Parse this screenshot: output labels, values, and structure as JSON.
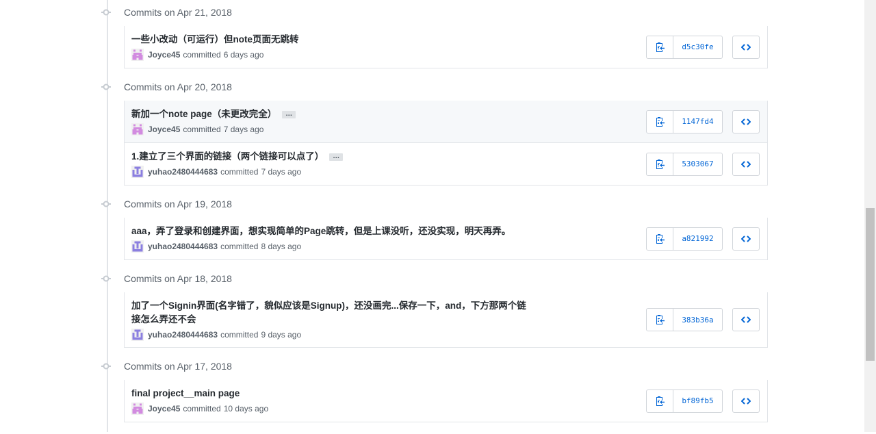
{
  "colors": {
    "accent": "#0366d6",
    "joyce_avatar": "#d28be0",
    "yuhao_avatar": "#8b7fe0"
  },
  "groups": [
    {
      "date_label": "Commits on Apr 21, 2018",
      "commits": [
        {
          "message": "一些小改动（可运行）但note页面无跳转",
          "author": "Joyce45",
          "verb": "committed",
          "time": "6 days ago",
          "sha": "d5c30fe",
          "has_more": false,
          "avatar": "joyce"
        }
      ]
    },
    {
      "date_label": "Commits on Apr 20, 2018",
      "commits": [
        {
          "message": "新加一个note page（未更改完全）",
          "author": "Joyce45",
          "verb": "committed",
          "time": "7 days ago",
          "sha": "1147fd4",
          "has_more": true,
          "more_label": "…",
          "avatar": "joyce",
          "highlight": true
        },
        {
          "message": "1.建立了三个界面的链接（两个链接可以点了）",
          "author": "yuhao2480444683",
          "verb": "committed",
          "time": "7 days ago",
          "sha": "5303067",
          "has_more": true,
          "more_label": "…",
          "avatar": "yuhao"
        }
      ]
    },
    {
      "date_label": "Commits on Apr 19, 2018",
      "commits": [
        {
          "message": "aaa，弄了登录和创建界面，想实现简单的Page跳转，但是上课没听，还没实现，明天再弄。",
          "author": "yuhao2480444683",
          "verb": "committed",
          "time": "8 days ago",
          "sha": "a821992",
          "has_more": false,
          "avatar": "yuhao"
        }
      ]
    },
    {
      "date_label": "Commits on Apr 18, 2018",
      "commits": [
        {
          "message": "加了一个Signin界面(名字错了，貌似应该是Signup)，还没画完...保存一下，and，下方那两个链接怎么弄还不会",
          "author": "yuhao2480444683",
          "verb": "committed",
          "time": "9 days ago",
          "sha": "383b36a",
          "has_more": false,
          "avatar": "yuhao"
        }
      ]
    },
    {
      "date_label": "Commits on Apr 17, 2018",
      "commits": [
        {
          "message": "final project__main page",
          "author": "Joyce45",
          "verb": "committed",
          "time": "10 days ago",
          "sha": "bf89fb5",
          "has_more": false,
          "avatar": "joyce"
        }
      ]
    }
  ]
}
